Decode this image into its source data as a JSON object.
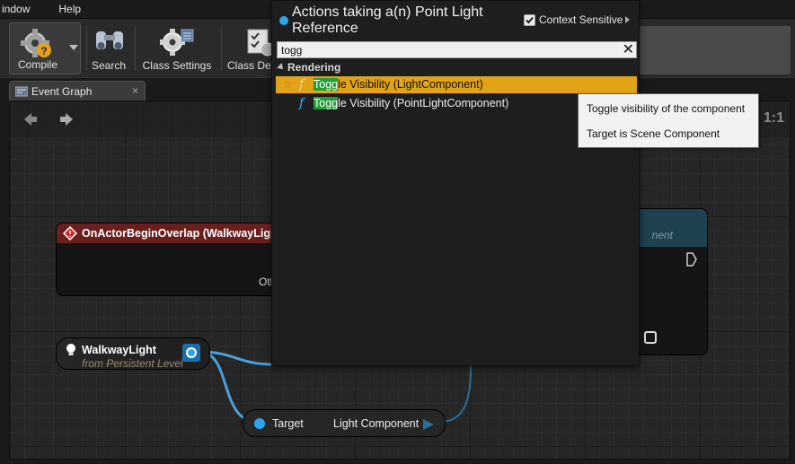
{
  "menu": {
    "items": [
      "indow",
      "Help"
    ]
  },
  "toolbar": {
    "compile_label": "Compile",
    "search_label": "Search",
    "class_settings_label": "Class Settings",
    "class_defaults_label": "Class Def"
  },
  "tabs": [
    {
      "label": "Event Graph"
    }
  ],
  "graph": {
    "zoom_label": "1:1",
    "event_node": {
      "title": "OnActorBeginOverlap (WalkwayLight",
      "pin_label": "Oth"
    },
    "right_node": {
      "subtitle": "nent"
    },
    "var_node": {
      "name": "WalkwayLight",
      "subtitle": "from Persistent Level"
    },
    "target_node": {
      "target_label": "Target",
      "output_label": "Light Component"
    }
  },
  "popup": {
    "title": "Actions taking a(n) Point Light Reference",
    "context_sensitive_label": "Context Sensitive",
    "context_sensitive_checked": true,
    "search": {
      "value": "togg"
    },
    "category": "Rendering",
    "items": [
      {
        "match": "Togg",
        "rest": "le Visibility (LightComponent)",
        "selected": true
      },
      {
        "match": "Togg",
        "rest": "le Visibility (PointLightComponent)",
        "selected": false
      }
    ]
  },
  "tooltip": {
    "line1": "Toggle visibility of the component",
    "line2": "Target is Scene Component"
  },
  "colors": {
    "selection": "#e3a318",
    "match_highlight": "#22a038",
    "function_icon": "#3ab6ff",
    "event_header": "#6a1f1f",
    "pin_blue": "#2aa6f0"
  }
}
